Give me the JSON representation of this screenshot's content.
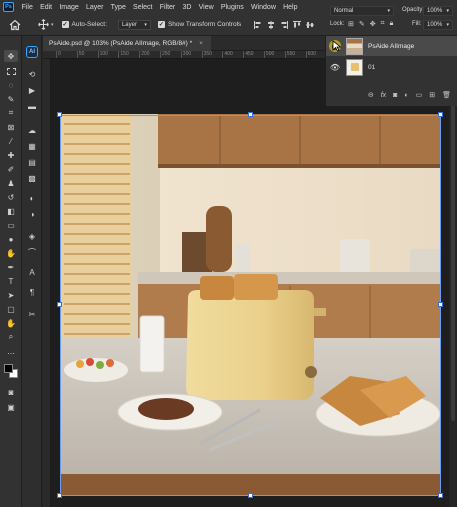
{
  "app": {
    "logo": "Ps"
  },
  "menu": [
    "File",
    "Edit",
    "Image",
    "Layer",
    "Type",
    "Select",
    "Filter",
    "3D",
    "View",
    "Plugins",
    "Window",
    "Help"
  ],
  "options": {
    "auto_select_label": "Auto-Select:",
    "auto_select_checked": true,
    "target_value": "Layer",
    "transform_label": "Show Transform Controls",
    "transform_checked": true
  },
  "layers_panel": {
    "blend_mode": "Normal",
    "opacity_label": "Opacity:",
    "opacity_value": "100%",
    "lock_label": "Lock:",
    "fill_label": "Fill:",
    "fill_value": "100%",
    "layers": [
      {
        "name": "PsAide AIImage",
        "visible": true,
        "selected": true
      },
      {
        "name": "01",
        "visible": true,
        "selected": false
      }
    ]
  },
  "document": {
    "tab_title": "PsAide.psd @ 103% (PsAide AIImage, RGB/8#) *",
    "close_glyph": "×"
  },
  "ruler": {
    "ticks": [
      "0",
      "50",
      "100",
      "150",
      "200",
      "250",
      "300",
      "350",
      "400",
      "450",
      "500",
      "550",
      "600",
      "650",
      "700",
      "750",
      "800",
      "850"
    ]
  },
  "colors": {
    "accent": "#31a8ff",
    "ui_bg": "#323232",
    "canvas_bg": "#1e1e1e"
  }
}
